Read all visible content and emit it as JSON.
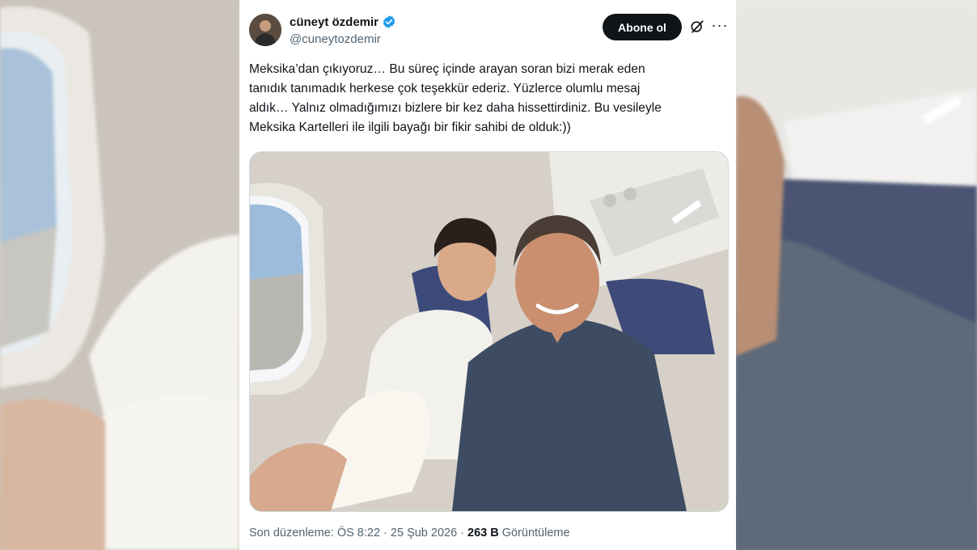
{
  "tweet": {
    "author_name": "cüneyt özdemir",
    "author_handle": "@cuneytozdemir",
    "follow_label": "Abone ol",
    "text_lines": [
      "Meksika’dan çıkıyoruz… Bu süreç içinde arayan soran bizi merak eden",
      "tanıdık tanımadık herkese çok teşekkür ederiz. Yüzlerce olumlu mesaj",
      "aldık… Yalnız olmadığımızı bizlere bir kez daha hissettirdiniz. Bu vesileyle",
      "Meksika Kartelleri ile ilgili bayağı bir fikir sahibi de olduk:))"
    ],
    "edited_label": "Son düzenleme: ÖS 8:22 · 25 Şub 2026 ·",
    "views_count": "263 B",
    "views_label": "Görüntüleme"
  },
  "icons": {
    "verified": "verified-badge-icon",
    "grok": "grok-icon",
    "more": "more-options-icon"
  },
  "colors": {
    "verified_blue": "#1d9bf0",
    "button_bg": "#0f1419",
    "secondary_text": "#536471"
  }
}
